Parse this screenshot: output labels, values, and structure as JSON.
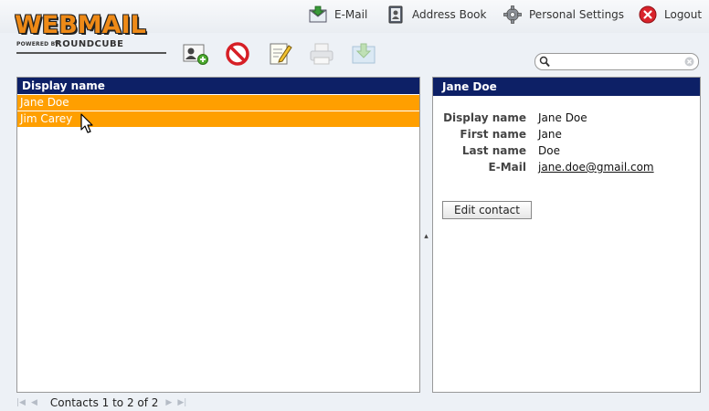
{
  "brand": {
    "logo_text": "WEBMAIL",
    "powered_by": "POWERED BY",
    "product": "ROUNDCUBE"
  },
  "topnav": {
    "email_label": "E-Mail",
    "addressbook_label": "Address Book",
    "settings_label": "Personal Settings",
    "logout_label": "Logout"
  },
  "toolbar": {
    "icons": [
      "add-contact-icon",
      "delete-icon",
      "compose-icon",
      "print-icon",
      "export-icon"
    ]
  },
  "search": {
    "value": "",
    "placeholder": ""
  },
  "contacts": {
    "header": "Display name",
    "rows": [
      {
        "name": "Jane Doe"
      },
      {
        "name": "Jim Carey"
      }
    ],
    "selected_color": "#ff9f00"
  },
  "detail": {
    "title": "Jane Doe",
    "display_name_label": "Display name",
    "display_name": "Jane Doe",
    "first_name_label": "First name",
    "first_name": "Jane",
    "last_name_label": "Last name",
    "last_name": "Doe",
    "email_label": "E-Mail",
    "email": "jane.doe@gmail.com",
    "edit_button": "Edit contact"
  },
  "footer": {
    "count_text": "Contacts 1 to 2 of 2"
  },
  "colors": {
    "header_bg": "#0d2066",
    "accent": "#ff9f00",
    "brand": "#ee8a17"
  }
}
